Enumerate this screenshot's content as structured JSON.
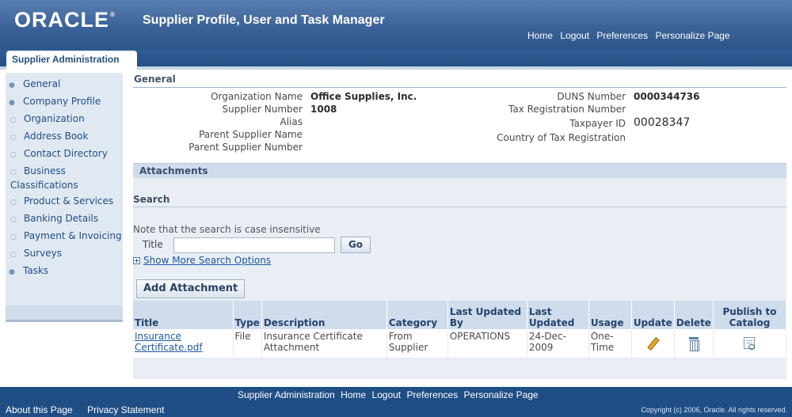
{
  "header": {
    "logo": "ORACLE",
    "logo_mark": "®",
    "app_title": "Supplier Profile, User and Task Manager",
    "global_links": [
      "Home",
      "Logout",
      "Preferences",
      "Personalize Page"
    ]
  },
  "tab": {
    "label": "Supplier Administration"
  },
  "sidebar": {
    "items": [
      {
        "label": "General",
        "level": "top"
      },
      {
        "label": "Company Profile",
        "level": "top"
      },
      {
        "label": "Organization",
        "level": "sub"
      },
      {
        "label": "Address Book",
        "level": "sub"
      },
      {
        "label": "Contact Directory",
        "level": "sub"
      },
      {
        "label": "Business Classifications",
        "level": "sub"
      },
      {
        "label": "Product & Services",
        "level": "sub"
      },
      {
        "label": "Banking Details",
        "level": "sub"
      },
      {
        "label": "Payment & Invoicing",
        "level": "sub"
      },
      {
        "label": "Surveys",
        "level": "sub"
      },
      {
        "label": "Tasks",
        "level": "top"
      }
    ]
  },
  "general": {
    "title": "General",
    "org_name_label": "Organization Name",
    "org_name_value": "Office Supplies, Inc.",
    "supplier_number_label": "Supplier Number",
    "supplier_number_value": "1008",
    "alias_label": "Alias",
    "parent_name_label": "Parent Supplier Name",
    "parent_number_label": "Parent Supplier Number",
    "duns_label": "DUNS Number",
    "duns_value": "0000344736",
    "tax_reg_label": "Tax Registration Number",
    "taxpayer_label": "Taxpayer ID",
    "taxpayer_value": "00028347",
    "country_tax_label": "Country of Tax Registration"
  },
  "attachments": {
    "title": "Attachments",
    "search_title": "Search",
    "note": "Note that the search is case insensitive",
    "title_field_label": "Title",
    "title_field_value": "",
    "go_label": "Go",
    "more_options": "Show More Search Options",
    "add_button": "Add Attachment",
    "columns": [
      "Title",
      "Type",
      "Description",
      "Category",
      "Last Updated By",
      "Last Updated",
      "Usage",
      "Update",
      "Delete",
      "Publish to Catalog"
    ],
    "rows": [
      {
        "title": "Insurance Certificate.pdf",
        "type": "File",
        "description": "Insurance Certificate Attachment",
        "category": "From Supplier",
        "last_updated_by": "OPERATIONS",
        "last_updated": "24-Dec-2009",
        "usage": "One-Time",
        "update_icon": "pencil-icon",
        "delete_icon": "trash-icon",
        "publish_icon": "publish-icon"
      }
    ]
  },
  "footer": {
    "links": [
      "Supplier Administration",
      "Home",
      "Logout",
      "Preferences",
      "Personalize Page"
    ],
    "left_links": [
      "About this Page",
      "Privacy Statement"
    ],
    "copyright": "Copyright (c) 2006, Oracle. All rights reserved."
  }
}
